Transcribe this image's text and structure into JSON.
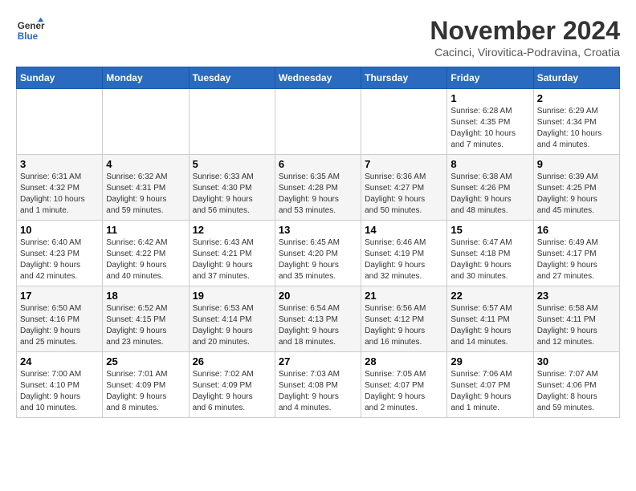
{
  "header": {
    "logo_line1": "General",
    "logo_line2": "Blue",
    "month_year": "November 2024",
    "location": "Cacinci, Virovitica-Podravina, Croatia"
  },
  "weekdays": [
    "Sunday",
    "Monday",
    "Tuesday",
    "Wednesday",
    "Thursday",
    "Friday",
    "Saturday"
  ],
  "weeks": [
    [
      {
        "day": "",
        "info": ""
      },
      {
        "day": "",
        "info": ""
      },
      {
        "day": "",
        "info": ""
      },
      {
        "day": "",
        "info": ""
      },
      {
        "day": "",
        "info": ""
      },
      {
        "day": "1",
        "info": "Sunrise: 6:28 AM\nSunset: 4:35 PM\nDaylight: 10 hours\nand 7 minutes."
      },
      {
        "day": "2",
        "info": "Sunrise: 6:29 AM\nSunset: 4:34 PM\nDaylight: 10 hours\nand 4 minutes."
      }
    ],
    [
      {
        "day": "3",
        "info": "Sunrise: 6:31 AM\nSunset: 4:32 PM\nDaylight: 10 hours\nand 1 minute."
      },
      {
        "day": "4",
        "info": "Sunrise: 6:32 AM\nSunset: 4:31 PM\nDaylight: 9 hours\nand 59 minutes."
      },
      {
        "day": "5",
        "info": "Sunrise: 6:33 AM\nSunset: 4:30 PM\nDaylight: 9 hours\nand 56 minutes."
      },
      {
        "day": "6",
        "info": "Sunrise: 6:35 AM\nSunset: 4:28 PM\nDaylight: 9 hours\nand 53 minutes."
      },
      {
        "day": "7",
        "info": "Sunrise: 6:36 AM\nSunset: 4:27 PM\nDaylight: 9 hours\nand 50 minutes."
      },
      {
        "day": "8",
        "info": "Sunrise: 6:38 AM\nSunset: 4:26 PM\nDaylight: 9 hours\nand 48 minutes."
      },
      {
        "day": "9",
        "info": "Sunrise: 6:39 AM\nSunset: 4:25 PM\nDaylight: 9 hours\nand 45 minutes."
      }
    ],
    [
      {
        "day": "10",
        "info": "Sunrise: 6:40 AM\nSunset: 4:23 PM\nDaylight: 9 hours\nand 42 minutes."
      },
      {
        "day": "11",
        "info": "Sunrise: 6:42 AM\nSunset: 4:22 PM\nDaylight: 9 hours\nand 40 minutes."
      },
      {
        "day": "12",
        "info": "Sunrise: 6:43 AM\nSunset: 4:21 PM\nDaylight: 9 hours\nand 37 minutes."
      },
      {
        "day": "13",
        "info": "Sunrise: 6:45 AM\nSunset: 4:20 PM\nDaylight: 9 hours\nand 35 minutes."
      },
      {
        "day": "14",
        "info": "Sunrise: 6:46 AM\nSunset: 4:19 PM\nDaylight: 9 hours\nand 32 minutes."
      },
      {
        "day": "15",
        "info": "Sunrise: 6:47 AM\nSunset: 4:18 PM\nDaylight: 9 hours\nand 30 minutes."
      },
      {
        "day": "16",
        "info": "Sunrise: 6:49 AM\nSunset: 4:17 PM\nDaylight: 9 hours\nand 27 minutes."
      }
    ],
    [
      {
        "day": "17",
        "info": "Sunrise: 6:50 AM\nSunset: 4:16 PM\nDaylight: 9 hours\nand 25 minutes."
      },
      {
        "day": "18",
        "info": "Sunrise: 6:52 AM\nSunset: 4:15 PM\nDaylight: 9 hours\nand 23 minutes."
      },
      {
        "day": "19",
        "info": "Sunrise: 6:53 AM\nSunset: 4:14 PM\nDaylight: 9 hours\nand 20 minutes."
      },
      {
        "day": "20",
        "info": "Sunrise: 6:54 AM\nSunset: 4:13 PM\nDaylight: 9 hours\nand 18 minutes."
      },
      {
        "day": "21",
        "info": "Sunrise: 6:56 AM\nSunset: 4:12 PM\nDaylight: 9 hours\nand 16 minutes."
      },
      {
        "day": "22",
        "info": "Sunrise: 6:57 AM\nSunset: 4:11 PM\nDaylight: 9 hours\nand 14 minutes."
      },
      {
        "day": "23",
        "info": "Sunrise: 6:58 AM\nSunset: 4:11 PM\nDaylight: 9 hours\nand 12 minutes."
      }
    ],
    [
      {
        "day": "24",
        "info": "Sunrise: 7:00 AM\nSunset: 4:10 PM\nDaylight: 9 hours\nand 10 minutes."
      },
      {
        "day": "25",
        "info": "Sunrise: 7:01 AM\nSunset: 4:09 PM\nDaylight: 9 hours\nand 8 minutes."
      },
      {
        "day": "26",
        "info": "Sunrise: 7:02 AM\nSunset: 4:09 PM\nDaylight: 9 hours\nand 6 minutes."
      },
      {
        "day": "27",
        "info": "Sunrise: 7:03 AM\nSunset: 4:08 PM\nDaylight: 9 hours\nand 4 minutes."
      },
      {
        "day": "28",
        "info": "Sunrise: 7:05 AM\nSunset: 4:07 PM\nDaylight: 9 hours\nand 2 minutes."
      },
      {
        "day": "29",
        "info": "Sunrise: 7:06 AM\nSunset: 4:07 PM\nDaylight: 9 hours\nand 1 minute."
      },
      {
        "day": "30",
        "info": "Sunrise: 7:07 AM\nSunset: 4:06 PM\nDaylight: 8 hours\nand 59 minutes."
      }
    ]
  ]
}
